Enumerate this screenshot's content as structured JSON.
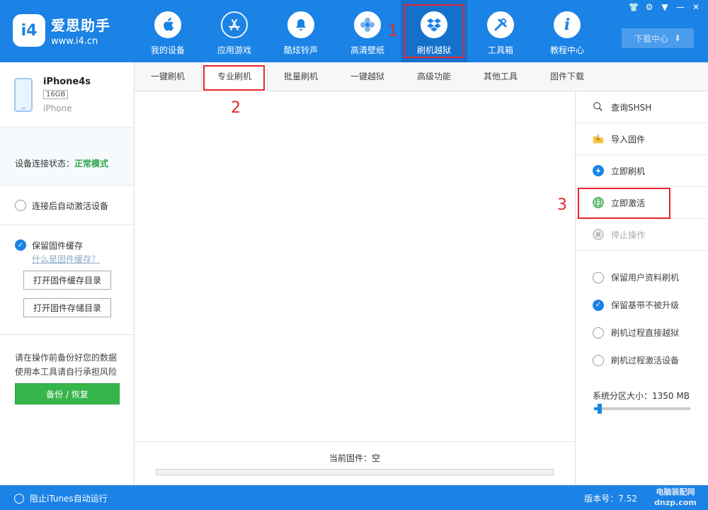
{
  "app": {
    "logo_badge": "i4",
    "name": "爱思助手",
    "url": "www.i4.cn"
  },
  "nav": [
    {
      "label": "我的设备",
      "icon": "apple-icon",
      "glyph": "",
      "active": false
    },
    {
      "label": "应用游戏",
      "icon": "app-store-icon",
      "glyph": "A",
      "active": false
    },
    {
      "label": "酷炫铃声",
      "icon": "bell-icon",
      "glyph": "🔔",
      "active": false
    },
    {
      "label": "高清壁纸",
      "icon": "flower-icon",
      "glyph": "❀",
      "active": false
    },
    {
      "label": "刷机越狱",
      "icon": "dropbox-icon",
      "glyph": "❖",
      "active": true
    },
    {
      "label": "工具箱",
      "icon": "tools-icon",
      "glyph": "✕",
      "active": false
    },
    {
      "label": "教程中心",
      "icon": "info-icon",
      "glyph": "i",
      "active": false
    }
  ],
  "header": {
    "download_center": "下载中心"
  },
  "device": {
    "name": "iPhone4s",
    "capacity": "16GB",
    "model": "iPhone",
    "status_label": "设备连接状态：",
    "status_value": "正常模式"
  },
  "left": {
    "auto_activate": "连接后自动激活设备",
    "keep_cache": "保留固件缓存",
    "what_is_cache": "什么是固件缓存？",
    "open_cache_dir": "打开固件缓存目录",
    "open_store_dir": "打开固件存储目录",
    "warning_line1": "请在操作前备份好您的数据",
    "warning_line2": "使用本工具请自行承担风险",
    "backup_restore": "备份 / 恢复"
  },
  "subtabs": [
    {
      "label": "一键刷机",
      "active": false
    },
    {
      "label": "专业刷机",
      "active": true
    },
    {
      "label": "批量刷机",
      "active": false
    },
    {
      "label": "一键越狱",
      "active": false
    },
    {
      "label": "高级功能",
      "active": false
    },
    {
      "label": "其他工具",
      "active": false
    },
    {
      "label": "固件下载",
      "active": false
    }
  ],
  "center": {
    "current_firmware": "当前固件：空"
  },
  "actions": [
    {
      "label": "查询SHSH",
      "icon": "search-shsh-icon",
      "disabled": false
    },
    {
      "label": "导入固件",
      "icon": "import-folder-icon",
      "disabled": false
    },
    {
      "label": "立即刷机",
      "icon": "flash-icon",
      "disabled": false
    },
    {
      "label": "立即激活",
      "icon": "globe-icon",
      "disabled": false
    },
    {
      "label": "停止操作",
      "icon": "stop-icon",
      "disabled": true
    }
  ],
  "options": [
    {
      "label": "保留用户资料刷机",
      "checked": false
    },
    {
      "label": "保留基带不被升级",
      "checked": true
    },
    {
      "label": "刷机过程直接越狱",
      "checked": false
    },
    {
      "label": "刷机过程激活设备",
      "checked": false
    }
  ],
  "system_partition": {
    "label": "系统分区大小：1350 MB",
    "level": 0.06
  },
  "footer": {
    "block_itunes": "阻止iTunes自动运行",
    "version": "版本号：7.52",
    "watermark_line1": "电脑装配网",
    "watermark_line2": "dnzp.com"
  },
  "annotations": [
    "1",
    "2",
    "3"
  ],
  "colors": {
    "brand_blue": "#1b82e6",
    "status_green": "#2aa44a",
    "annotation_red": "#e8262d"
  }
}
